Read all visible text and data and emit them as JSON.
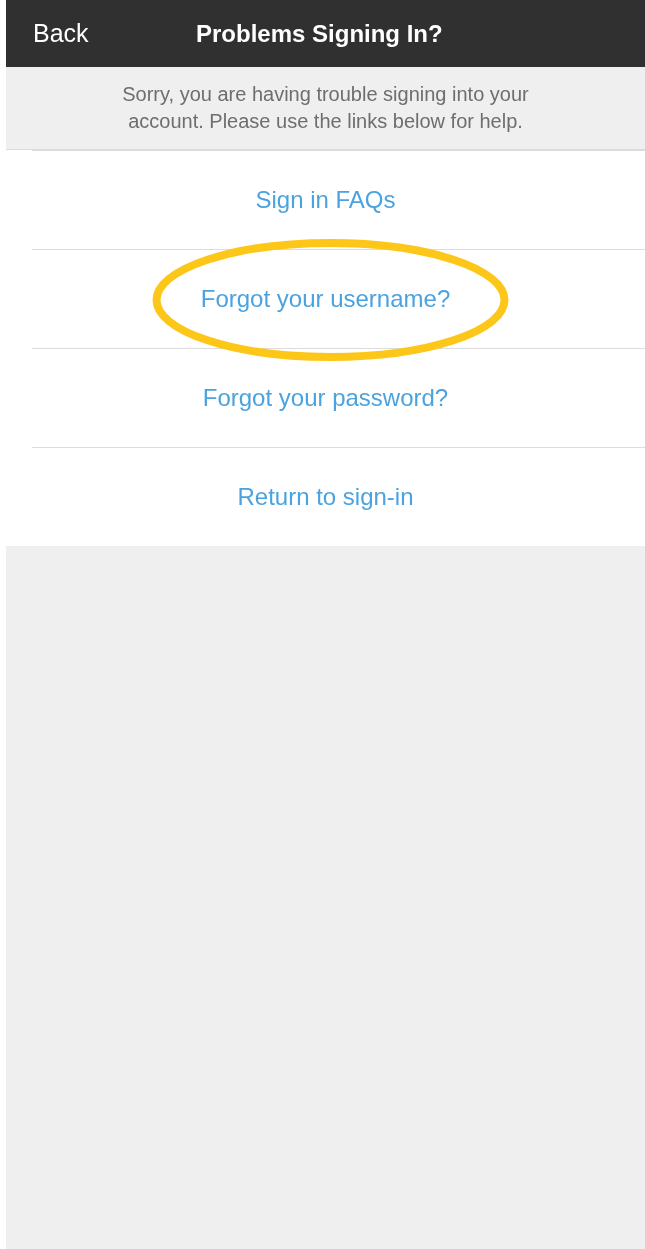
{
  "header": {
    "back": "Back",
    "title": "Problems Signing In?"
  },
  "message": "Sorry, you are having trouble signing into your account. Please use the links below for help.",
  "links": [
    {
      "label": "Sign in FAQs",
      "highlighted": false
    },
    {
      "label": "Forgot your username?",
      "highlighted": true
    },
    {
      "label": "Forgot your password?",
      "highlighted": false
    },
    {
      "label": "Return to sign-in",
      "highlighted": false
    }
  ]
}
